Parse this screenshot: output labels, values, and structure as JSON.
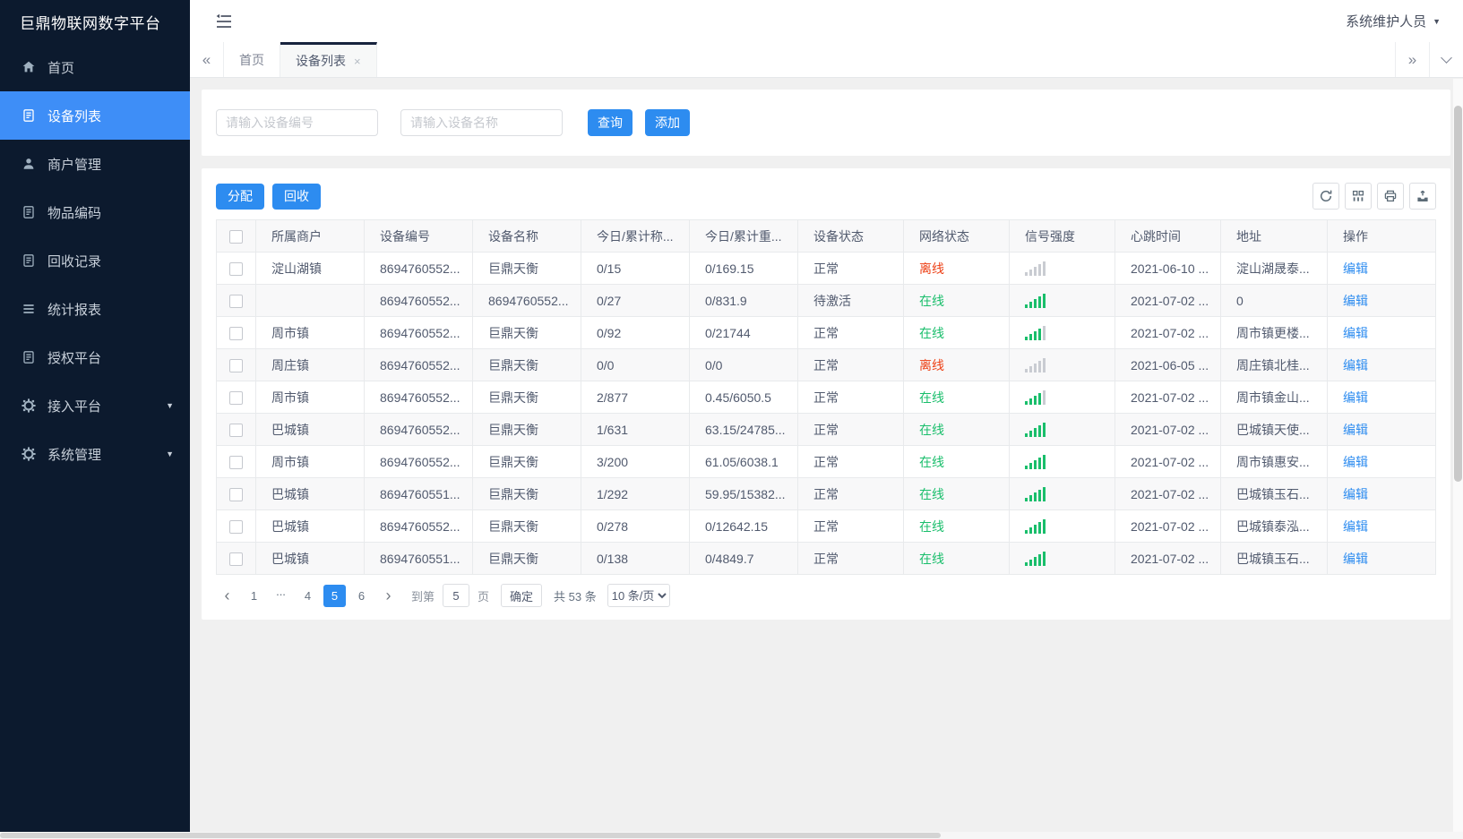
{
  "app": {
    "title": "巨鼎物联网数字平台",
    "user": "系统维护人员",
    "caret_icon": "▼"
  },
  "sidebar": {
    "items": [
      {
        "key": "home",
        "icon": "home",
        "label": "首页",
        "active": false,
        "expandable": false
      },
      {
        "key": "devices",
        "icon": "doc",
        "label": "设备列表",
        "active": true,
        "expandable": false
      },
      {
        "key": "merchants",
        "icon": "person",
        "label": "商户管理",
        "active": false,
        "expandable": false
      },
      {
        "key": "item-code",
        "icon": "doc",
        "label": "物品编码",
        "active": false,
        "expandable": false
      },
      {
        "key": "recycle-records",
        "icon": "doc",
        "label": "回收记录",
        "active": false,
        "expandable": false
      },
      {
        "key": "reports",
        "icon": "lines",
        "label": "统计报表",
        "active": false,
        "expandable": false
      },
      {
        "key": "auth-platform",
        "icon": "doc",
        "label": "授权平台",
        "active": false,
        "expandable": false
      },
      {
        "key": "access-platform",
        "icon": "gear",
        "label": "接入平台",
        "active": false,
        "expandable": true
      },
      {
        "key": "system",
        "icon": "gear",
        "label": "系统管理",
        "active": false,
        "expandable": true
      }
    ],
    "expand_icon": "▼"
  },
  "tabbar": {
    "scroll_left_icon": "«",
    "scroll_right_icon": "»",
    "close_icon": "×",
    "tabs": [
      {
        "key": "home",
        "label": "首页",
        "active": false,
        "closable": false
      },
      {
        "key": "devices",
        "label": "设备列表",
        "active": true,
        "closable": true
      }
    ]
  },
  "search": {
    "device_no_placeholder": "请输入设备编号",
    "device_name_placeholder": "请输入设备名称",
    "query_label": "查询",
    "add_label": "添加"
  },
  "toolbar": {
    "assign_label": "分配",
    "recycle_label": "回收",
    "icons": [
      "refresh",
      "columns",
      "print",
      "export"
    ]
  },
  "table": {
    "columns": [
      "所属商户",
      "设备编号",
      "设备名称",
      "今日/累计称...",
      "今日/累计重...",
      "设备状态",
      "网络状态",
      "信号强度",
      "心跳时间",
      "地址",
      "操作"
    ],
    "edit_label": "编辑",
    "rows": [
      {
        "merchant": "淀山湖镇",
        "device_no": "8694760552...",
        "device_name": "巨鼎天衡",
        "today_count": "0/15",
        "today_weight": "0/169.15",
        "device_status": "正常",
        "network_status": "离线",
        "online": false,
        "signal": 0,
        "heartbeat": "2021-06-10 ...",
        "address": "淀山湖晟泰..."
      },
      {
        "merchant": "",
        "device_no": "8694760552...",
        "device_name": "8694760552...",
        "today_count": "0/27",
        "today_weight": "0/831.9",
        "device_status": "待激活",
        "network_status": "在线",
        "online": true,
        "signal": 5,
        "heartbeat": "2021-07-02 ...",
        "address": "0"
      },
      {
        "merchant": "周市镇",
        "device_no": "8694760552...",
        "device_name": "巨鼎天衡",
        "today_count": "0/92",
        "today_weight": "0/21744",
        "device_status": "正常",
        "network_status": "在线",
        "online": true,
        "signal": 4,
        "heartbeat": "2021-07-02 ...",
        "address": "周市镇更楼..."
      },
      {
        "merchant": "周庄镇",
        "device_no": "8694760552...",
        "device_name": "巨鼎天衡",
        "today_count": "0/0",
        "today_weight": "0/0",
        "device_status": "正常",
        "network_status": "离线",
        "online": false,
        "signal": 0,
        "heartbeat": "2021-06-05 ...",
        "address": "周庄镇北桂..."
      },
      {
        "merchant": "周市镇",
        "device_no": "8694760552...",
        "device_name": "巨鼎天衡",
        "today_count": "2/877",
        "today_weight": "0.45/6050.5",
        "device_status": "正常",
        "network_status": "在线",
        "online": true,
        "signal": 4,
        "heartbeat": "2021-07-02 ...",
        "address": "周市镇金山..."
      },
      {
        "merchant": "巴城镇",
        "device_no": "8694760552...",
        "device_name": "巨鼎天衡",
        "today_count": "1/631",
        "today_weight": "63.15/24785...",
        "device_status": "正常",
        "network_status": "在线",
        "online": true,
        "signal": 5,
        "heartbeat": "2021-07-02 ...",
        "address": "巴城镇天使..."
      },
      {
        "merchant": "周市镇",
        "device_no": "8694760552...",
        "device_name": "巨鼎天衡",
        "today_count": "3/200",
        "today_weight": "61.05/6038.1",
        "device_status": "正常",
        "network_status": "在线",
        "online": true,
        "signal": 5,
        "heartbeat": "2021-07-02 ...",
        "address": "周市镇惠安..."
      },
      {
        "merchant": "巴城镇",
        "device_no": "8694760551...",
        "device_name": "巨鼎天衡",
        "today_count": "1/292",
        "today_weight": "59.95/15382...",
        "device_status": "正常",
        "network_status": "在线",
        "online": true,
        "signal": 5,
        "heartbeat": "2021-07-02 ...",
        "address": "巴城镇玉石..."
      },
      {
        "merchant": "巴城镇",
        "device_no": "8694760552...",
        "device_name": "巨鼎天衡",
        "today_count": "0/278",
        "today_weight": "0/12642.15",
        "device_status": "正常",
        "network_status": "在线",
        "online": true,
        "signal": 5,
        "heartbeat": "2021-07-02 ...",
        "address": "巴城镇泰泓..."
      },
      {
        "merchant": "巴城镇",
        "device_no": "8694760551...",
        "device_name": "巨鼎天衡",
        "today_count": "0/138",
        "today_weight": "0/4849.7",
        "device_status": "正常",
        "network_status": "在线",
        "online": true,
        "signal": 5,
        "heartbeat": "2021-07-02 ...",
        "address": "巴城镇玉石..."
      }
    ]
  },
  "pagination": {
    "prev_icon": "‹",
    "next_icon": "›",
    "pages": [
      {
        "label": "1",
        "active": false
      },
      {
        "label": "...",
        "ellipsis": true
      },
      {
        "label": "4",
        "active": false
      },
      {
        "label": "5",
        "active": true
      },
      {
        "label": "6",
        "active": false
      }
    ],
    "goto_label": "到第",
    "goto_value": "5",
    "page_label": "页",
    "confirm_label": "确定",
    "total_label": "共 53 条",
    "page_size": "10 条/页"
  },
  "colors": {
    "primary": "#2d8cf0",
    "sidebar_active": "#3e8ef7",
    "online_green": "#19be6b",
    "offline_red": "#ed3f14",
    "sidebar_bg": "#0c1a2e"
  }
}
